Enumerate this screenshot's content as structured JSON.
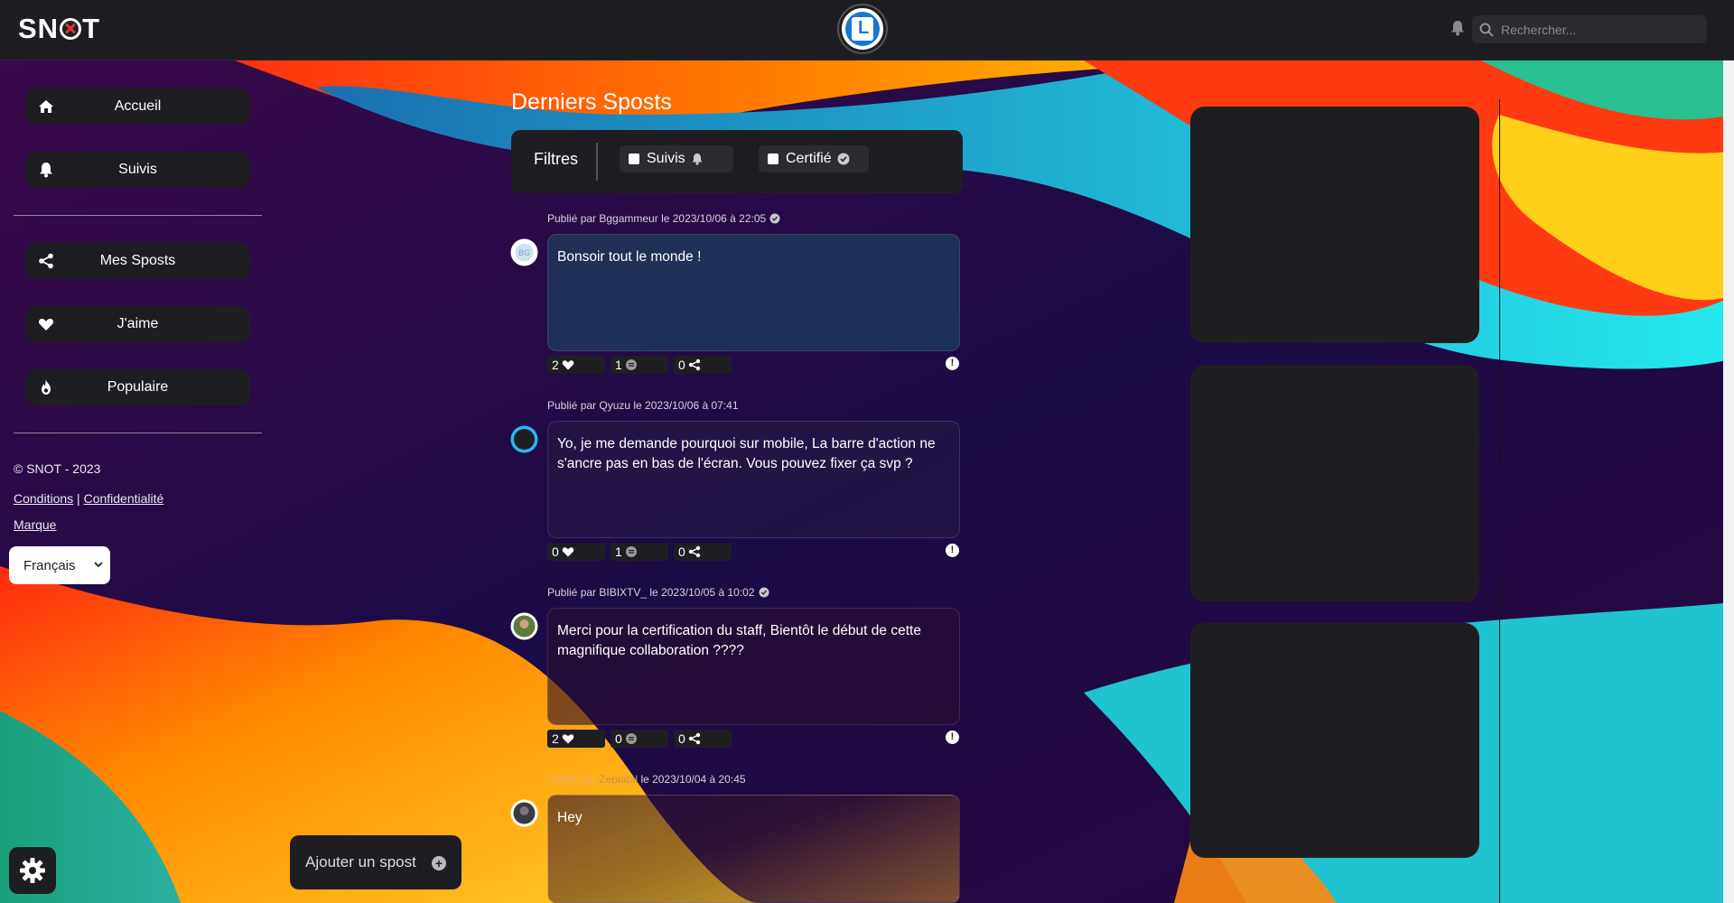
{
  "app": {
    "logo": "SN",
    "logo_tail": "T"
  },
  "search": {
    "placeholder": "Rechercher..."
  },
  "sidebar": {
    "items": [
      {
        "label": "Accueil",
        "icon": "home-icon"
      },
      {
        "label": "Suivis",
        "icon": "bell-icon"
      },
      {
        "label": "Mes Sposts",
        "icon": "share-icon"
      },
      {
        "label": "J'aime",
        "icon": "heart-icon"
      },
      {
        "label": "Populaire",
        "icon": "fire-icon"
      }
    ],
    "copyright": "© SNOT - 2023",
    "links": {
      "conditions": "Conditions",
      "separator": "|",
      "privacy": "Confidentialité",
      "brand": "Marque"
    },
    "language": "Français"
  },
  "add_spost": {
    "label": "Ajouter un spost",
    "plus": "+"
  },
  "feed": {
    "title": "Derniers Sposts",
    "filters": {
      "label": "Filtres",
      "followed": "Suivis",
      "certified": "Certifié"
    },
    "posts": [
      {
        "meta": "Publié par Bggammeur le 2023/10/06 à 22:05",
        "verified": true,
        "text": "Bonsoir tout le monde !",
        "likes": "2",
        "comments": "1",
        "shares": "0"
      },
      {
        "meta": "Publié par Qyuzu le 2023/10/06 à 07:41",
        "verified": false,
        "text": "Yo, je me demande pourquoi sur mobile, La barre d'action ne s'ancre pas en bas de l'écran. Vous pouvez fixer ça svp ?",
        "likes": "0",
        "comments": "1",
        "shares": "0"
      },
      {
        "meta": "Publié par BIBIXTV_ le 2023/10/05 à 10:02",
        "verified": true,
        "text": "Merci pour la certification du staff, Bientôt le début de cette magnifique collaboration ????",
        "likes": "2",
        "comments": "0",
        "shares": "0"
      },
      {
        "meta_prefix": "Publié par",
        "meta_user": "Zeplatal",
        "meta_suffix": "le 2023/10/04 à 20:45",
        "verified": false,
        "text": "Hey"
      }
    ],
    "report_symbol": "!"
  },
  "colors": {
    "panel": "#1e1e22",
    "accent": "#1976d2"
  }
}
